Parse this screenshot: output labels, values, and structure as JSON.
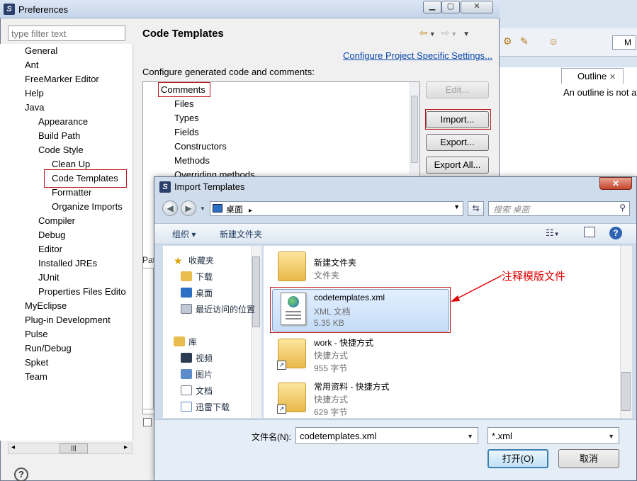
{
  "preferences": {
    "title": "Preferences",
    "filter_placeholder": "type filter text",
    "tree": [
      {
        "label": "General",
        "level": 1
      },
      {
        "label": "Ant",
        "level": 1
      },
      {
        "label": "FreeMarker Editor",
        "level": 1
      },
      {
        "label": "Help",
        "level": 1
      },
      {
        "label": "Java",
        "level": 1
      },
      {
        "label": "Appearance",
        "level": 2
      },
      {
        "label": "Build Path",
        "level": 2
      },
      {
        "label": "Code Style",
        "level": 2
      },
      {
        "label": "Clean Up",
        "level": 3
      },
      {
        "label": "Code Templates",
        "level": 3
      },
      {
        "label": "Formatter",
        "level": 3
      },
      {
        "label": "Organize Imports",
        "level": 3
      },
      {
        "label": "Compiler",
        "level": 2
      },
      {
        "label": "Debug",
        "level": 2
      },
      {
        "label": "Editor",
        "level": 2
      },
      {
        "label": "Installed JREs",
        "level": 2
      },
      {
        "label": "JUnit",
        "level": 2
      },
      {
        "label": "Properties Files Edito",
        "level": 2
      },
      {
        "label": "MyEclipse",
        "level": 1
      },
      {
        "label": "Plug-in Development",
        "level": 1
      },
      {
        "label": "Pulse",
        "level": 1
      },
      {
        "label": "Run/Debug",
        "level": 1
      },
      {
        "label": "Spket",
        "level": 1
      },
      {
        "label": "Team",
        "level": 1
      }
    ],
    "help_glyph": "?"
  },
  "code_templates": {
    "title": "Code Templates",
    "config_link": "Configure Project Specific Settings...",
    "config_label": "Configure generated code and comments:",
    "tree": [
      "Comments",
      "Files",
      "Types",
      "Fields",
      "Constructors",
      "Methods",
      "Overriding methods"
    ],
    "buttons": {
      "edit": "Edit...",
      "import": "Import...",
      "export": "Export...",
      "export_all": "Export All..."
    },
    "pattern_label": "Pat"
  },
  "eclipse_bg": {
    "outline_tab": "Outline",
    "outline_text": "An outline is not a",
    "perspective": "M"
  },
  "dialog": {
    "title": "Import Templates",
    "address": "桌面",
    "search_placeholder": "搜索 桌面",
    "commands": {
      "organize": "组织 ▾",
      "new_folder": "新建文件夹"
    },
    "nav": {
      "favorites": "收藏夹",
      "downloads": "下载",
      "desktop": "桌面",
      "recent": "最近访问的位置",
      "libraries": "库",
      "videos": "视频",
      "pictures": "图片",
      "documents": "文档",
      "xunlei": "迅雷下载"
    },
    "files": [
      {
        "name": "新建文件夹",
        "type": "文件夹",
        "size": ""
      },
      {
        "name": "codetemplates.xml",
        "type": "XML 文档",
        "size": "5.35 KB"
      },
      {
        "name": "work - 快捷方式",
        "type": "快捷方式",
        "size": "955 字节"
      },
      {
        "name": "常用资料 - 快捷方式",
        "type": "快捷方式",
        "size": "629 字节"
      }
    ],
    "annotation": "注释模版文件",
    "filename_label": "文件名(N):",
    "filename_value": "codetemplates.xml",
    "filetype_value": "*.xml",
    "open_button": "打开(O)",
    "cancel_button": "取消",
    "colors": {
      "annotation": "#e00000",
      "selection": "#c5ddf8",
      "highlight_box": "#c0161b"
    }
  }
}
